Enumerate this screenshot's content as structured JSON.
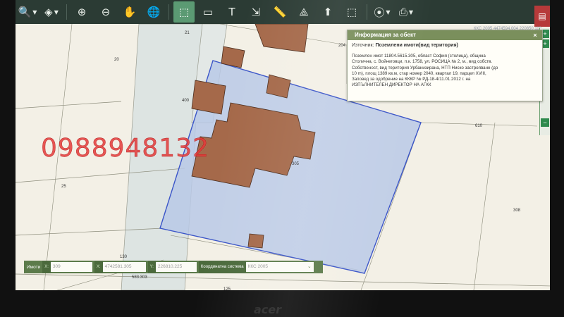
{
  "toolbar": {
    "tools": [
      {
        "name": "search-tool",
        "icon": "search-icon",
        "glyph": "🔍",
        "dropdown": true
      },
      {
        "name": "layers-tool",
        "icon": "layers-icon",
        "glyph": "◈",
        "dropdown": true
      },
      {
        "name": "zoom-in-tool",
        "icon": "zoom-in-icon",
        "glyph": "⊕",
        "dropdown": false
      },
      {
        "name": "zoom-out-tool",
        "icon": "zoom-out-icon",
        "glyph": "⊖",
        "dropdown": false
      },
      {
        "name": "pan-tool",
        "icon": "hand-icon",
        "glyph": "✋",
        "dropdown": false
      },
      {
        "name": "globe-tool",
        "icon": "globe-icon",
        "glyph": "🌐",
        "dropdown": false
      },
      {
        "name": "info-select-tool",
        "icon": "select-area-icon",
        "glyph": "⬚",
        "dropdown": false,
        "active": true
      },
      {
        "name": "frame-tool",
        "icon": "frame-icon",
        "glyph": "▭",
        "dropdown": false
      },
      {
        "name": "text-tool",
        "icon": "text-icon",
        "glyph": "T",
        "dropdown": false
      },
      {
        "name": "dimension-tool",
        "icon": "dimension-icon",
        "glyph": "⇲",
        "dropdown": false
      },
      {
        "name": "measure-tool",
        "icon": "ruler-icon",
        "glyph": "📏",
        "dropdown": false
      },
      {
        "name": "area-tool",
        "icon": "polygon-icon",
        "glyph": "⟁",
        "dropdown": false
      },
      {
        "name": "upload-tool",
        "icon": "upload-icon",
        "glyph": "⬆",
        "dropdown": false
      },
      {
        "name": "bbox-tool",
        "icon": "bbox-icon",
        "glyph": "⬚",
        "dropdown": false
      },
      {
        "name": "location-tool",
        "icon": "location-pin-icon",
        "glyph": "⦿",
        "dropdown": true
      },
      {
        "name": "print-tool",
        "icon": "printer-icon",
        "glyph": "⎙",
        "dropdown": true
      }
    ]
  },
  "map": {
    "labels": {
      "n21": "21",
      "n20": "20",
      "n204": "204",
      "n400": "400",
      "n25": "25",
      "n610": "610",
      "n308": "308",
      "n130": "130",
      "n583": "583.303",
      "n125": "125",
      "n305": "305"
    },
    "watermark": "ККС 2005 4474594.004 220850.119",
    "colors": {
      "parcel_fill": "#b9c9e6",
      "parcel_stroke": "#3b55c8",
      "building_fill": "#a5694a",
      "building_stroke": "#4a2c1c",
      "line": "#8b8b7a",
      "road": "#dbe3e3"
    }
  },
  "info_panel": {
    "title": "Информация за обект",
    "source_prefix": "Източник:",
    "source_value": "Поземлени имоти(вид територия)",
    "lines": [
      "Поземлен имот 11804.5615.305, област София (столица), община",
      "Столична, с. Войнеговци, п.к. 1758, ул. РОСИЦА № 2, м., вид собств.",
      "Собственост, вид територия Урбанизирана, НТП Ниско застрояване (до",
      "10 m), площ 1389 кв.м, стар номер 2040, квартал 19, парцел XVIII,",
      "Заповед за одобрение на КККР № РД-18-4/11.01.2012 г. на",
      "ИЗПЪЛНИТЕЛЕН ДИРЕКТОР НА АГКК"
    ]
  },
  "overlay": {
    "phone": "0988948132"
  },
  "coords_bar": {
    "label": "Имоти",
    "x_tag": "X:",
    "y_tag": "Y:",
    "field1": "309",
    "field2": "4742581.305",
    "field3": "226810.225",
    "system_label": "Координатна система",
    "system_value": "ККС 2005"
  },
  "right_strip": {
    "buttons": [
      "+",
      "+",
      "−"
    ]
  }
}
